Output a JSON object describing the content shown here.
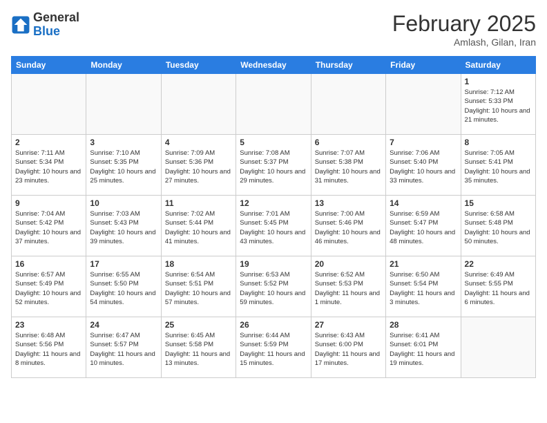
{
  "header": {
    "logo_line1": "General",
    "logo_line2": "Blue",
    "month": "February 2025",
    "location": "Amlash, Gilan, Iran"
  },
  "weekdays": [
    "Sunday",
    "Monday",
    "Tuesday",
    "Wednesday",
    "Thursday",
    "Friday",
    "Saturday"
  ],
  "weeks": [
    [
      {
        "day": "",
        "info": ""
      },
      {
        "day": "",
        "info": ""
      },
      {
        "day": "",
        "info": ""
      },
      {
        "day": "",
        "info": ""
      },
      {
        "day": "",
        "info": ""
      },
      {
        "day": "",
        "info": ""
      },
      {
        "day": "1",
        "info": "Sunrise: 7:12 AM\nSunset: 5:33 PM\nDaylight: 10 hours and 21 minutes."
      }
    ],
    [
      {
        "day": "2",
        "info": "Sunrise: 7:11 AM\nSunset: 5:34 PM\nDaylight: 10 hours and 23 minutes."
      },
      {
        "day": "3",
        "info": "Sunrise: 7:10 AM\nSunset: 5:35 PM\nDaylight: 10 hours and 25 minutes."
      },
      {
        "day": "4",
        "info": "Sunrise: 7:09 AM\nSunset: 5:36 PM\nDaylight: 10 hours and 27 minutes."
      },
      {
        "day": "5",
        "info": "Sunrise: 7:08 AM\nSunset: 5:37 PM\nDaylight: 10 hours and 29 minutes."
      },
      {
        "day": "6",
        "info": "Sunrise: 7:07 AM\nSunset: 5:38 PM\nDaylight: 10 hours and 31 minutes."
      },
      {
        "day": "7",
        "info": "Sunrise: 7:06 AM\nSunset: 5:40 PM\nDaylight: 10 hours and 33 minutes."
      },
      {
        "day": "8",
        "info": "Sunrise: 7:05 AM\nSunset: 5:41 PM\nDaylight: 10 hours and 35 minutes."
      }
    ],
    [
      {
        "day": "9",
        "info": "Sunrise: 7:04 AM\nSunset: 5:42 PM\nDaylight: 10 hours and 37 minutes."
      },
      {
        "day": "10",
        "info": "Sunrise: 7:03 AM\nSunset: 5:43 PM\nDaylight: 10 hours and 39 minutes."
      },
      {
        "day": "11",
        "info": "Sunrise: 7:02 AM\nSunset: 5:44 PM\nDaylight: 10 hours and 41 minutes."
      },
      {
        "day": "12",
        "info": "Sunrise: 7:01 AM\nSunset: 5:45 PM\nDaylight: 10 hours and 43 minutes."
      },
      {
        "day": "13",
        "info": "Sunrise: 7:00 AM\nSunset: 5:46 PM\nDaylight: 10 hours and 46 minutes."
      },
      {
        "day": "14",
        "info": "Sunrise: 6:59 AM\nSunset: 5:47 PM\nDaylight: 10 hours and 48 minutes."
      },
      {
        "day": "15",
        "info": "Sunrise: 6:58 AM\nSunset: 5:48 PM\nDaylight: 10 hours and 50 minutes."
      }
    ],
    [
      {
        "day": "16",
        "info": "Sunrise: 6:57 AM\nSunset: 5:49 PM\nDaylight: 10 hours and 52 minutes."
      },
      {
        "day": "17",
        "info": "Sunrise: 6:55 AM\nSunset: 5:50 PM\nDaylight: 10 hours and 54 minutes."
      },
      {
        "day": "18",
        "info": "Sunrise: 6:54 AM\nSunset: 5:51 PM\nDaylight: 10 hours and 57 minutes."
      },
      {
        "day": "19",
        "info": "Sunrise: 6:53 AM\nSunset: 5:52 PM\nDaylight: 10 hours and 59 minutes."
      },
      {
        "day": "20",
        "info": "Sunrise: 6:52 AM\nSunset: 5:53 PM\nDaylight: 11 hours and 1 minute."
      },
      {
        "day": "21",
        "info": "Sunrise: 6:50 AM\nSunset: 5:54 PM\nDaylight: 11 hours and 3 minutes."
      },
      {
        "day": "22",
        "info": "Sunrise: 6:49 AM\nSunset: 5:55 PM\nDaylight: 11 hours and 6 minutes."
      }
    ],
    [
      {
        "day": "23",
        "info": "Sunrise: 6:48 AM\nSunset: 5:56 PM\nDaylight: 11 hours and 8 minutes."
      },
      {
        "day": "24",
        "info": "Sunrise: 6:47 AM\nSunset: 5:57 PM\nDaylight: 11 hours and 10 minutes."
      },
      {
        "day": "25",
        "info": "Sunrise: 6:45 AM\nSunset: 5:58 PM\nDaylight: 11 hours and 13 minutes."
      },
      {
        "day": "26",
        "info": "Sunrise: 6:44 AM\nSunset: 5:59 PM\nDaylight: 11 hours and 15 minutes."
      },
      {
        "day": "27",
        "info": "Sunrise: 6:43 AM\nSunset: 6:00 PM\nDaylight: 11 hours and 17 minutes."
      },
      {
        "day": "28",
        "info": "Sunrise: 6:41 AM\nSunset: 6:01 PM\nDaylight: 11 hours and 19 minutes."
      },
      {
        "day": "",
        "info": ""
      }
    ]
  ]
}
